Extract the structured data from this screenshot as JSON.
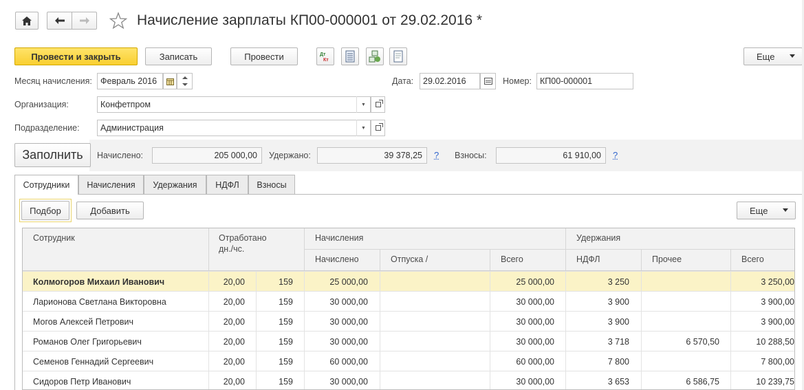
{
  "header": {
    "title": "Начисление зарплаты КП00-000001 от 29.02.2016 *"
  },
  "toolbar": {
    "post_close": "Провести и закрыть",
    "save": "Записать",
    "post": "Провести",
    "more": "Еще"
  },
  "form": {
    "month_label": "Месяц начисления:",
    "month_value": "Февраль 2016",
    "date_label": "Дата:",
    "date_value": "29.02.2016",
    "number_label": "Номер:",
    "number_value": "КП00-000001",
    "org_label": "Организация:",
    "org_value": "Конфетпром",
    "dept_label": "Подразделение:",
    "dept_value": "Администрация"
  },
  "totals": {
    "fill_label": "Заполнить",
    "accrued_label": "Начислено:",
    "accrued_value": "205 000,00",
    "withheld_label": "Удержано:",
    "withheld_value": "39 378,25",
    "contrib_label": "Взносы:",
    "contrib_value": "61 910,00",
    "help": "?"
  },
  "tabs": [
    "Сотрудники",
    "Начисления",
    "Удержания",
    "НДФЛ",
    "Взносы"
  ],
  "table_toolbar": {
    "pick": "Подбор",
    "add": "Добавить",
    "more": "Еще"
  },
  "table": {
    "h_employee": "Сотрудник",
    "h_worked_1": "Отработано",
    "h_worked_2": "дн./чс.",
    "h_accruals": "Начисления",
    "h_accrued": "Начислено",
    "h_vacation": "Отпуска /",
    "h_acc_total": "Всего",
    "h_deductions": "Удержания",
    "h_ndfl": "НДФЛ",
    "h_other": "Прочее",
    "h_ded_total": "Всего",
    "rows": [
      {
        "name": "Колмогоров Михаил Иванович",
        "days": "20,00",
        "hours": "159",
        "accrued": "25 000,00",
        "vacation": "",
        "acc_total": "25 000,00",
        "ndfl": "3 250",
        "other": "",
        "ded_total": "3 250,00"
      },
      {
        "name": "Ларионова Светлана Викторовна",
        "days": "20,00",
        "hours": "159",
        "accrued": "30 000,00",
        "vacation": "",
        "acc_total": "30 000,00",
        "ndfl": "3 900",
        "other": "",
        "ded_total": "3 900,00"
      },
      {
        "name": "Могов Алексей Петрович",
        "days": "20,00",
        "hours": "159",
        "accrued": "30 000,00",
        "vacation": "",
        "acc_total": "30 000,00",
        "ndfl": "3 900",
        "other": "",
        "ded_total": "3 900,00"
      },
      {
        "name": "Романов Олег Григорьевич",
        "days": "20,00",
        "hours": "159",
        "accrued": "30 000,00",
        "vacation": "",
        "acc_total": "30 000,00",
        "ndfl": "3 718",
        "other": "6 570,50",
        "ded_total": "10 288,50"
      },
      {
        "name": "Семенов Геннадий Сергеевич",
        "days": "20,00",
        "hours": "159",
        "accrued": "60 000,00",
        "vacation": "",
        "acc_total": "60 000,00",
        "ndfl": "7 800",
        "other": "",
        "ded_total": "7 800,00"
      },
      {
        "name": "Сидоров Петр Иванович",
        "days": "20,00",
        "hours": "159",
        "accrued": "30 000,00",
        "vacation": "",
        "acc_total": "30 000,00",
        "ndfl": "3 653",
        "other": "6 586,75",
        "ded_total": "10 239,75"
      }
    ]
  },
  "colors": {
    "accent_yellow": "#f9cf30",
    "selected_row": "#fbf3c7",
    "link_blue": "#3366cc"
  }
}
